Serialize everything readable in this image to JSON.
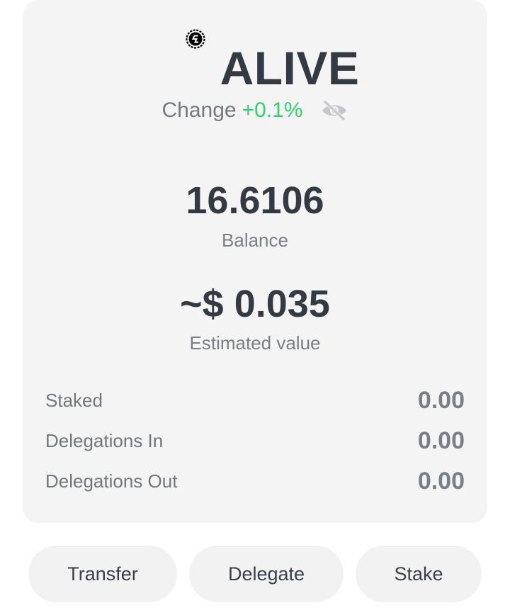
{
  "token": {
    "name": "ALIVE",
    "icon": "token-icon"
  },
  "change": {
    "label": "Change",
    "value": "+0.1%",
    "value_color": "#2fd06b",
    "visibility_icon": "eye-slash-icon"
  },
  "balance": {
    "value": "16.6106",
    "label": "Balance"
  },
  "estimated": {
    "value": "~$ 0.035",
    "label": "Estimated value"
  },
  "stats": [
    {
      "label": "Staked",
      "value": "0.00"
    },
    {
      "label": "Delegations In",
      "value": "0.00"
    },
    {
      "label": "Delegations Out",
      "value": "0.00"
    }
  ],
  "actions": {
    "transfer": "Transfer",
    "delegate": "Delegate",
    "stake": "Stake"
  }
}
